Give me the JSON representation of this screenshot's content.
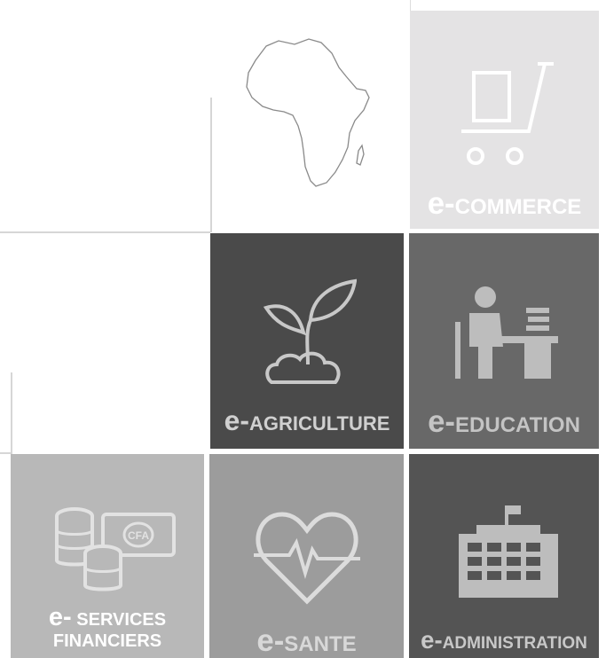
{
  "tiles": {
    "commerce": {
      "prefix": "e-",
      "name": "COMMERCE"
    },
    "agriculture": {
      "prefix": "e-",
      "name": "AGRICULTURE"
    },
    "education": {
      "prefix": "e-",
      "name": "EDUCATION"
    },
    "services": {
      "prefix": "e-",
      "name_line1": "SERVICES",
      "name_line2": "FINANCIERS"
    },
    "sante": {
      "prefix": "e-",
      "name": "SANTE"
    },
    "administration": {
      "prefix": "e-",
      "name": "ADMINISTRATION"
    }
  },
  "icons": {
    "africa": "africa-map-icon",
    "commerce": "shopping-cart-icon",
    "agriculture": "plant-sprout-icon",
    "education": "student-at-desk-icon",
    "services": "coins-and-banknote-icon",
    "banknote_text": "CFA",
    "sante": "heart-pulse-icon",
    "administration": "government-building-icon"
  },
  "colors": {
    "commerce_bg": "#e4e3e4",
    "agriculture_bg": "#4a4a4a",
    "education_bg": "#686868",
    "services_bg": "#b8b8b8",
    "sante_bg": "#9c9c9c",
    "administration_bg": "#545454"
  }
}
